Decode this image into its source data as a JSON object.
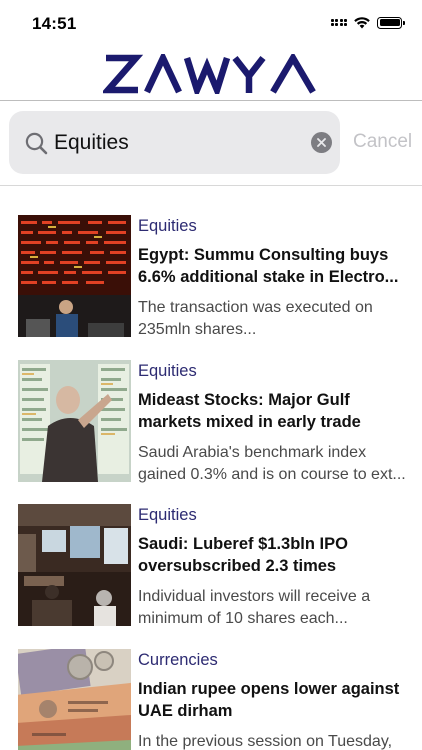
{
  "status_bar": {
    "time": "14:51"
  },
  "brand": {
    "logo_text": "ZAWYA",
    "color": "#1b1a6e"
  },
  "search": {
    "query": "Equities",
    "cancel_label": "Cancel"
  },
  "news": [
    {
      "category": "Equities",
      "headline": "Egypt: Summu Consulting buys 6.6% additional stake in Electro...",
      "summary": "The transaction was executed on 235mln shares..."
    },
    {
      "category": "Equities",
      "headline": "Mideast Stocks: Major Gulf markets mixed in early trade",
      "summary": "Saudi Arabia's benchmark index gained 0.3% and is on course to ext..."
    },
    {
      "category": "Equities",
      "headline": "Saudi: Luberef $1.3bln IPO oversubscribed 2.3 times",
      "summary": "Individual investors will receive a minimum of 10 shares each..."
    },
    {
      "category": "Currencies",
      "headline": "Indian rupee opens lower against UAE dirham",
      "summary": "In the previous session on Tuesday,"
    }
  ],
  "colors": {
    "category": "#2d2b72",
    "search_bg": "#e9e9eb",
    "cancel": "#c3c3c7"
  }
}
